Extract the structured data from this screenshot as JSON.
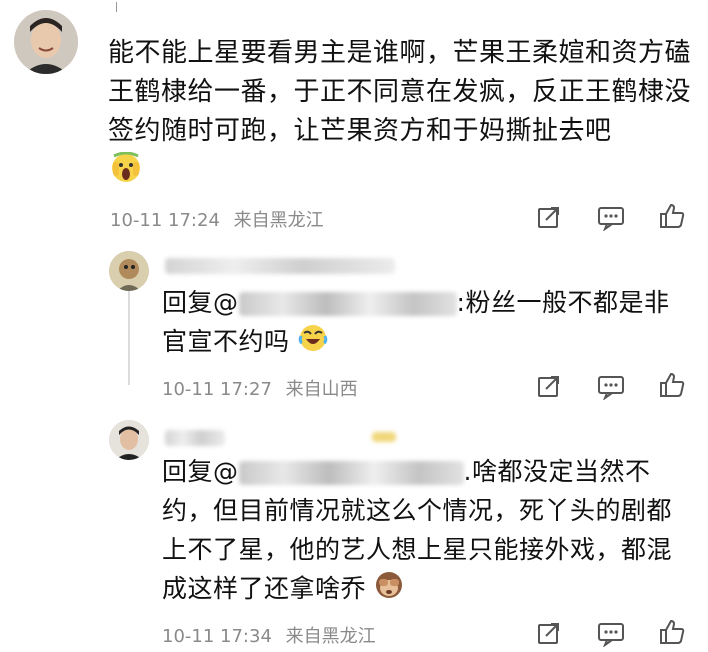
{
  "comments": [
    {
      "text": "能不能上星要看男主是谁啊，芒果王柔媗和资方磕王鹤棣给一番，于正不同意在发疯，反正王鹤棣没签约随时可跑，让芒果资方和于妈撕扯去吧",
      "emoji": "scream-emoji",
      "time": "10-11 17:24",
      "location": "来自黑龙江"
    }
  ],
  "replies": [
    {
      "prefix": "回复@",
      "text": ":粉丝一般不都是非官宣不约吗",
      "emoji": "laughing-tears-emoji",
      "time": "10-11 17:27",
      "location": "来自山西"
    },
    {
      "prefix": "回复@",
      "text": ".啥都没定当然不约，但目前情况就这么个情况，死丫头的剧都上不了星，他的艺人想上星只能接外戏，都混成这样了还拿啥乔",
      "emoji": "see-no-evil-monkey-emoji",
      "time": "10-11 17:34",
      "location": "来自黑龙江"
    }
  ],
  "actions": {
    "share_icon": "share-icon",
    "comment_icon": "comment-icon",
    "like_icon": "like-icon"
  },
  "colors": {
    "text": "#111111",
    "meta": "#8a8a8a",
    "icon": "#555555"
  }
}
